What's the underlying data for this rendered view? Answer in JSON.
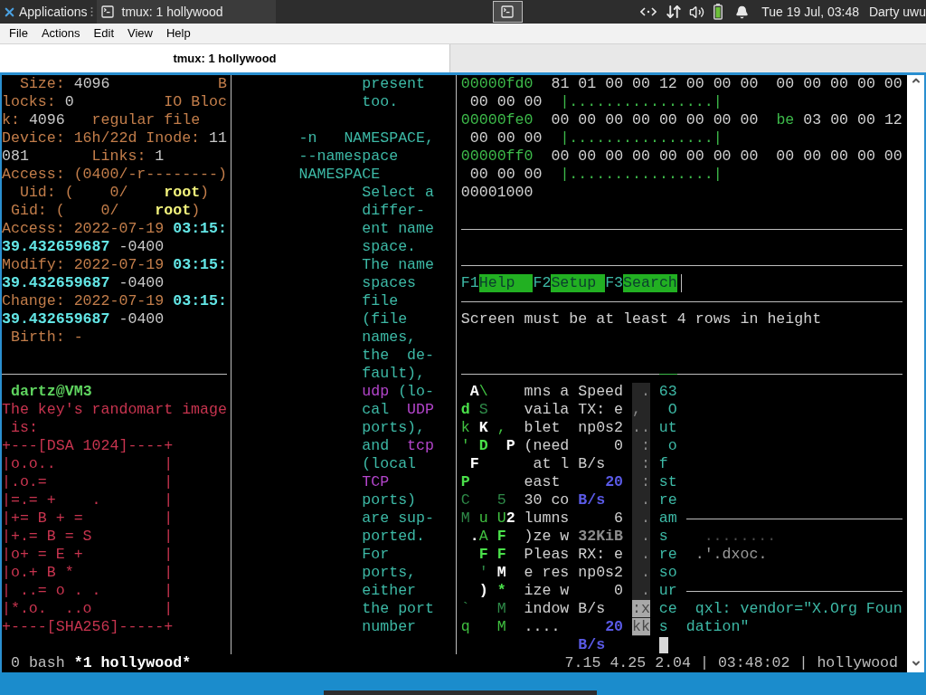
{
  "top_panel": {
    "menu_label": "Applications",
    "window_button": "tmux: 1 hollywood",
    "clock": "Tue 19 Jul, 03:48",
    "user": "Darty uwu"
  },
  "menu_bar": [
    "File",
    "Actions",
    "Edit",
    "View",
    "Help"
  ],
  "tabs": [
    {
      "label": "tmux: 1 hollywood",
      "selected": true
    }
  ],
  "terminal": {
    "left_top": [
      [
        {
          "kind": "label",
          "text": "  Size:"
        },
        {
          "kind": "value",
          "text": " 4096"
        },
        {
          "kind": "label",
          "text": "            B"
        }
      ],
      [
        {
          "kind": "label",
          "text": "locks:"
        },
        {
          "kind": "value",
          "text": " 0"
        },
        {
          "kind": "label",
          "text": "          IO Bloc"
        }
      ],
      [
        {
          "kind": "label",
          "text": "k:"
        },
        {
          "kind": "value",
          "text": " 4096"
        },
        {
          "kind": "label",
          "text": "   regular file"
        }
      ],
      [
        {
          "kind": "label",
          "text": "Device: 16h/22d Inode:"
        },
        {
          "kind": "value",
          "text": " 11"
        }
      ],
      [
        {
          "kind": "value",
          "text": "081"
        },
        {
          "kind": "label",
          "text": "       Links:"
        },
        {
          "kind": "value",
          "text": " 1"
        }
      ],
      [
        {
          "kind": "label",
          "text": "Access: (0400/-r--------)"
        }
      ],
      [
        {
          "kind": "label",
          "text": "  Uid: (    0/"
        },
        {
          "kind": "owner",
          "text": "    root"
        },
        {
          "kind": "label",
          "text": ")"
        }
      ],
      [
        {
          "kind": "label",
          "text": " Gid: (    0/"
        },
        {
          "kind": "owner",
          "text": "    root"
        },
        {
          "kind": "label",
          "text": ")"
        }
      ],
      [
        {
          "kind": "label",
          "text": "Access: 2022-07-19"
        },
        {
          "kind": "time",
          "text": " 03:15:"
        }
      ],
      [
        {
          "kind": "time",
          "text": "39.432659687"
        },
        {
          "kind": "value",
          "text": " -0400"
        }
      ],
      [
        {
          "kind": "label",
          "text": "Modify: 2022-07-19"
        },
        {
          "kind": "time",
          "text": " 03:15:"
        }
      ],
      [
        {
          "kind": "time",
          "text": "39.432659687"
        },
        {
          "kind": "value",
          "text": " -0400"
        }
      ],
      [
        {
          "kind": "label",
          "text": "Change: 2022-07-19"
        },
        {
          "kind": "time",
          "text": " 03:15:"
        }
      ],
      [
        {
          "kind": "time",
          "text": "39.432659687"
        },
        {
          "kind": "value",
          "text": " -0400"
        }
      ],
      [
        {
          "kind": "label",
          "text": " Birth: -"
        }
      ]
    ],
    "left_bottom": [
      [
        {
          "kind": "prompt",
          "text": " dartz@VM3"
        }
      ],
      [
        {
          "kind": "art",
          "text": "The key's randomart image"
        }
      ],
      [
        {
          "kind": "art",
          "text": " is:"
        }
      ],
      [
        {
          "kind": "art",
          "text": "+---[DSA 1024]----+"
        }
      ],
      [
        {
          "kind": "art",
          "text": "|o.o..            |"
        }
      ],
      [
        {
          "kind": "art",
          "text": "|.o.=             |"
        }
      ],
      [
        {
          "kind": "art",
          "text": "|=.= +    .       |"
        }
      ],
      [
        {
          "kind": "art",
          "text": "|+= B + =         |"
        }
      ],
      [
        {
          "kind": "art",
          "text": "|+.= B = S        |"
        }
      ],
      [
        {
          "kind": "art",
          "text": "|o+ = E +         |"
        }
      ],
      [
        {
          "kind": "art",
          "text": "|o.+ B *          |"
        }
      ],
      [
        {
          "kind": "art",
          "text": "| ..= o . .       |"
        }
      ],
      [
        {
          "kind": "art",
          "text": "|*.o.  ..o        |"
        }
      ],
      [
        {
          "kind": "art",
          "text": "+----[SHA256]-----+"
        }
      ]
    ],
    "middle": [
      [
        [
          {
            "kind": "prose",
            "text": "              present"
          }
        ],
        [
          {
            "kind": "prose",
            "text": "              too."
          }
        ]
      ],
      [
        [
          {
            "kind": "prose",
            "text": "       -n   NAMESPACE,"
          }
        ],
        [
          {
            "kind": "prose",
            "text": "       --namespace"
          }
        ],
        [
          {
            "kind": "prose",
            "text": "       NAMESPACE"
          }
        ],
        [
          {
            "kind": "prose",
            "text": "              Select a"
          }
        ],
        [
          {
            "kind": "prose",
            "text": "              differ-"
          }
        ],
        [
          {
            "kind": "prose",
            "text": "              ent name"
          }
        ],
        [
          {
            "kind": "prose",
            "text": "              space."
          }
        ],
        [
          {
            "kind": "prose",
            "text": "              The name"
          }
        ],
        [
          {
            "kind": "prose",
            "text": "              spaces"
          }
        ],
        [
          {
            "kind": "prose",
            "text": "              file"
          }
        ],
        [
          {
            "kind": "prose",
            "text": "              (file"
          }
        ],
        [
          {
            "kind": "prose",
            "text": "              names,"
          }
        ],
        [
          {
            "kind": "prose",
            "text": "              the  de-"
          }
        ],
        [
          {
            "kind": "prose",
            "text": "              fault),"
          }
        ],
        [
          {
            "kind": "keyword",
            "text": "              udp"
          },
          {
            "kind": "prose",
            "text": " (lo-"
          }
        ],
        [
          {
            "kind": "prose",
            "text": "              cal"
          },
          {
            "kind": "keyword",
            "text": "  UDP"
          }
        ],
        [
          {
            "kind": "prose",
            "text": "              ports),"
          }
        ],
        [
          {
            "kind": "prose",
            "text": "              and"
          },
          {
            "kind": "keyword",
            "text": "  tcp"
          }
        ],
        [
          {
            "kind": "prose",
            "text": "              (local"
          }
        ],
        [
          {
            "kind": "keyword",
            "text": "              TCP"
          }
        ],
        [
          {
            "kind": "prose",
            "text": "              ports)"
          }
        ],
        [
          {
            "kind": "prose",
            "text": "              are sup-"
          }
        ],
        [
          {
            "kind": "prose",
            "text": "              ported."
          }
        ],
        [
          {
            "kind": "prose",
            "text": "              For"
          }
        ],
        [
          {
            "kind": "prose",
            "text": "              ports,"
          }
        ],
        [
          {
            "kind": "prose",
            "text": "              either"
          }
        ],
        [
          {
            "kind": "prose",
            "text": "              the port"
          }
        ],
        [
          {
            "kind": "prose",
            "text": "              number"
          }
        ]
      ]
    ],
    "hexdump": [
      [
        {
          "kind": "offset",
          "text": "00000fd0"
        },
        {
          "kind": "hex",
          "text": "  81 01 00 00 12 00 00 00  00 00 00 00 00"
        }
      ],
      [
        {
          "kind": "hex",
          "text": " 00 00 00"
        },
        {
          "kind": "ascii",
          "text": "  |................|"
        }
      ],
      [
        {
          "kind": "offset",
          "text": "00000fe0"
        },
        {
          "kind": "hex",
          "text": "  00 00 00 00 00 00 00 00"
        },
        {
          "kind": "hexhi",
          "text": "  be"
        },
        {
          "kind": "hex",
          "text": " 03 00 00 12"
        }
      ],
      [
        {
          "kind": "hex",
          "text": " 00 00 00"
        },
        {
          "kind": "ascii",
          "text": "  |................|"
        }
      ],
      [
        {
          "kind": "offset",
          "text": "00000ff0"
        },
        {
          "kind": "hex",
          "text": "  00 00 00 00 00 00 00 00  00 00 00 00 00"
        }
      ],
      [
        {
          "kind": "hex",
          "text": " 00 00 00"
        },
        {
          "kind": "ascii",
          "text": "  |................|"
        }
      ],
      [
        {
          "kind": "hex",
          "text": "00001000"
        }
      ]
    ],
    "function_keys": [
      {
        "key": "F1",
        "label": "Help"
      },
      {
        "key": "F2",
        "label": "Setup"
      },
      {
        "key": "F3",
        "label": "Search"
      }
    ],
    "message": "Screen must be at least 4 rows in height",
    "bottom_panes": [
      {
        "active": false,
        "lines": [
          [
            {
              "kind": "bright",
              "text": " A"
            },
            {
              "kind": "green",
              "text": "\\"
            }
          ],
          [
            {
              "kind": "greenbold",
              "text": "d"
            },
            {
              "kind": "dimgreen",
              "text": " S"
            }
          ],
          [
            {
              "kind": "green",
              "text": "k"
            },
            {
              "kind": "bright",
              "text": " K"
            },
            {
              "kind": "green",
              "text": " ,"
            }
          ],
          [
            {
              "kind": "green",
              "text": "'"
            },
            {
              "kind": "greenbold",
              "text": " D"
            },
            {
              "kind": "bright",
              "text": "  P"
            }
          ],
          [
            {
              "kind": "bright",
              "text": " F"
            }
          ],
          [
            {
              "kind": "greenbold",
              "text": "P"
            }
          ],
          [
            {
              "kind": "dimgreen",
              "text": "C   5"
            }
          ],
          [
            {
              "kind": "dimgreen",
              "text": "M"
            },
            {
              "kind": "green",
              "text": " u U"
            },
            {
              "kind": "bright",
              "text": "2"
            }
          ],
          [
            {
              "kind": "bright",
              "text": " ."
            },
            {
              "kind": "green",
              "text": "A"
            },
            {
              "kind": "greenbold",
              "text": " F"
            }
          ],
          [
            {
              "kind": "greenbold",
              "text": "  F F"
            }
          ],
          [
            {
              "kind": "dimgreen",
              "text": "  '"
            },
            {
              "kind": "bright",
              "text": " M"
            }
          ],
          [
            {
              "kind": "bright",
              "text": "  )"
            },
            {
              "kind": "greenbold",
              "text": " *"
            }
          ],
          [
            {
              "kind": "dimgreen",
              "text": "`   M"
            }
          ],
          [
            {
              "kind": "green",
              "text": "q   M"
            }
          ]
        ]
      },
      {
        "active": false,
        "lines": [
          [
            {
              "kind": "plain",
              "text": "mns a"
            }
          ],
          [
            {
              "kind": "plain",
              "text": "vaila"
            }
          ],
          [
            {
              "kind": "plain",
              "text": "blet"
            }
          ],
          [
            {
              "kind": "plain",
              "text": "(need"
            }
          ],
          [
            {
              "kind": "plain",
              "text": " at l"
            }
          ],
          [
            {
              "kind": "plain",
              "text": "east"
            }
          ],
          [
            {
              "kind": "plain",
              "text": "30 co"
            }
          ],
          [
            {
              "kind": "plain",
              "text": "lumns"
            }
          ],
          [
            {
              "kind": "plain",
              "text": ")ze w"
            }
          ],
          [
            {
              "kind": "plain",
              "text": "Pleas"
            }
          ],
          [
            {
              "kind": "plain",
              "text": "e res"
            }
          ],
          [
            {
              "kind": "plain",
              "text": "ize w"
            }
          ],
          [
            {
              "kind": "plain",
              "text": "indow"
            }
          ],
          [
            {
              "kind": "plain",
              "text": "...."
            }
          ]
        ]
      },
      {
        "active": false,
        "lines": [
          [
            {
              "kind": "plain",
              "text": "Speed"
            }
          ],
          [
            {
              "kind": "plain",
              "text": "TX: e"
            }
          ],
          [
            {
              "kind": "plain",
              "text": "np0s2"
            }
          ],
          [
            {
              "kind": "plain",
              "text": "    0"
            }
          ],
          [
            {
              "kind": "plain",
              "text": "B/s"
            }
          ],
          [
            {
              "kind": "rate",
              "text": "   20"
            }
          ],
          [
            {
              "kind": "rate",
              "text": "B/s"
            }
          ],
          [
            {
              "kind": "plain",
              "text": "    6"
            }
          ],
          [
            {
              "kind": "size",
              "text": "32KiB"
            }
          ],
          [
            {
              "kind": "plain",
              "text": "RX: e"
            }
          ],
          [
            {
              "kind": "plain",
              "text": "np0s2"
            }
          ],
          [
            {
              "kind": "plain",
              "text": "    0"
            }
          ],
          [
            {
              "kind": "plain",
              "text": "B/s"
            }
          ],
          [
            {
              "kind": "rate",
              "text": "   20"
            }
          ],
          [
            {
              "kind": "rate",
              "text": "B/s"
            }
          ]
        ]
      },
      {
        "active": false,
        "lines": [
          [
            {
              "kind": "shade",
              "text": " ."
            }
          ],
          [
            {
              "kind": "shade",
              "text": ", "
            }
          ],
          [
            {
              "kind": "shade",
              "text": ".."
            }
          ],
          [
            {
              "kind": "shade",
              "text": " :"
            }
          ],
          [
            {
              "kind": "shade",
              "text": " :"
            }
          ],
          [
            {
              "kind": "shade",
              "text": " :"
            }
          ],
          [
            {
              "kind": "shade",
              "text": " ."
            }
          ],
          [
            {
              "kind": "shade",
              "text": " ."
            }
          ],
          [
            {
              "kind": "shade",
              "text": " ."
            }
          ],
          [
            {
              "kind": "shade",
              "text": " ."
            }
          ],
          [
            {
              "kind": "shade",
              "text": " ."
            }
          ],
          [
            {
              "kind": "shade",
              "text": " ."
            }
          ],
          [
            {
              "kind": "shadehi",
              "text": ":x"
            }
          ],
          [
            {
              "kind": "shadehi",
              "text": "kk"
            }
          ]
        ]
      },
      {
        "active": true,
        "lines": [
          [
            {
              "kind": "prose",
              "text": "63"
            }
          ],
          [
            {
              "kind": "prose",
              "text": " O"
            }
          ],
          [
            {
              "kind": "prose",
              "text": "ut"
            }
          ],
          [
            {
              "kind": "prose",
              "text": " o"
            }
          ],
          [
            {
              "kind": "prose",
              "text": "f"
            }
          ],
          [
            {
              "kind": "prose",
              "text": "st"
            }
          ],
          [
            {
              "kind": "prose",
              "text": "re"
            }
          ],
          [
            {
              "kind": "prose",
              "text": "am"
            }
          ],
          [
            {
              "kind": "prose",
              "text": "s"
            }
          ],
          [
            {
              "kind": "prose",
              "text": "re"
            }
          ],
          [
            {
              "kind": "prose",
              "text": "so"
            }
          ],
          [
            {
              "kind": "prose",
              "text": "ur"
            }
          ],
          [
            {
              "kind": "prose",
              "text": "ce"
            }
          ],
          [
            {
              "kind": "prose",
              "text": "s"
            }
          ]
        ]
      }
    ],
    "corner_middle": [
      [
        {
          "kind": "faint",
          "text": "  ........"
        }
      ],
      [
        {
          "kind": "dim",
          "text": " .'.dxoc."
        }
      ]
    ],
    "corner_lower": [
      [
        {
          "kind": "prose",
          "text": " qxl: vendor=\"X.Org Foun"
        }
      ],
      [
        {
          "kind": "prose",
          "text": "dation\""
        }
      ]
    ],
    "status": {
      "windows": [
        {
          "label": "0 bash",
          "selected": false
        },
        {
          "label": "*1 hollywood*",
          "selected": true
        }
      ],
      "info": "7.15 4.25 2.04 | 03:48:02 | hollywood"
    }
  }
}
